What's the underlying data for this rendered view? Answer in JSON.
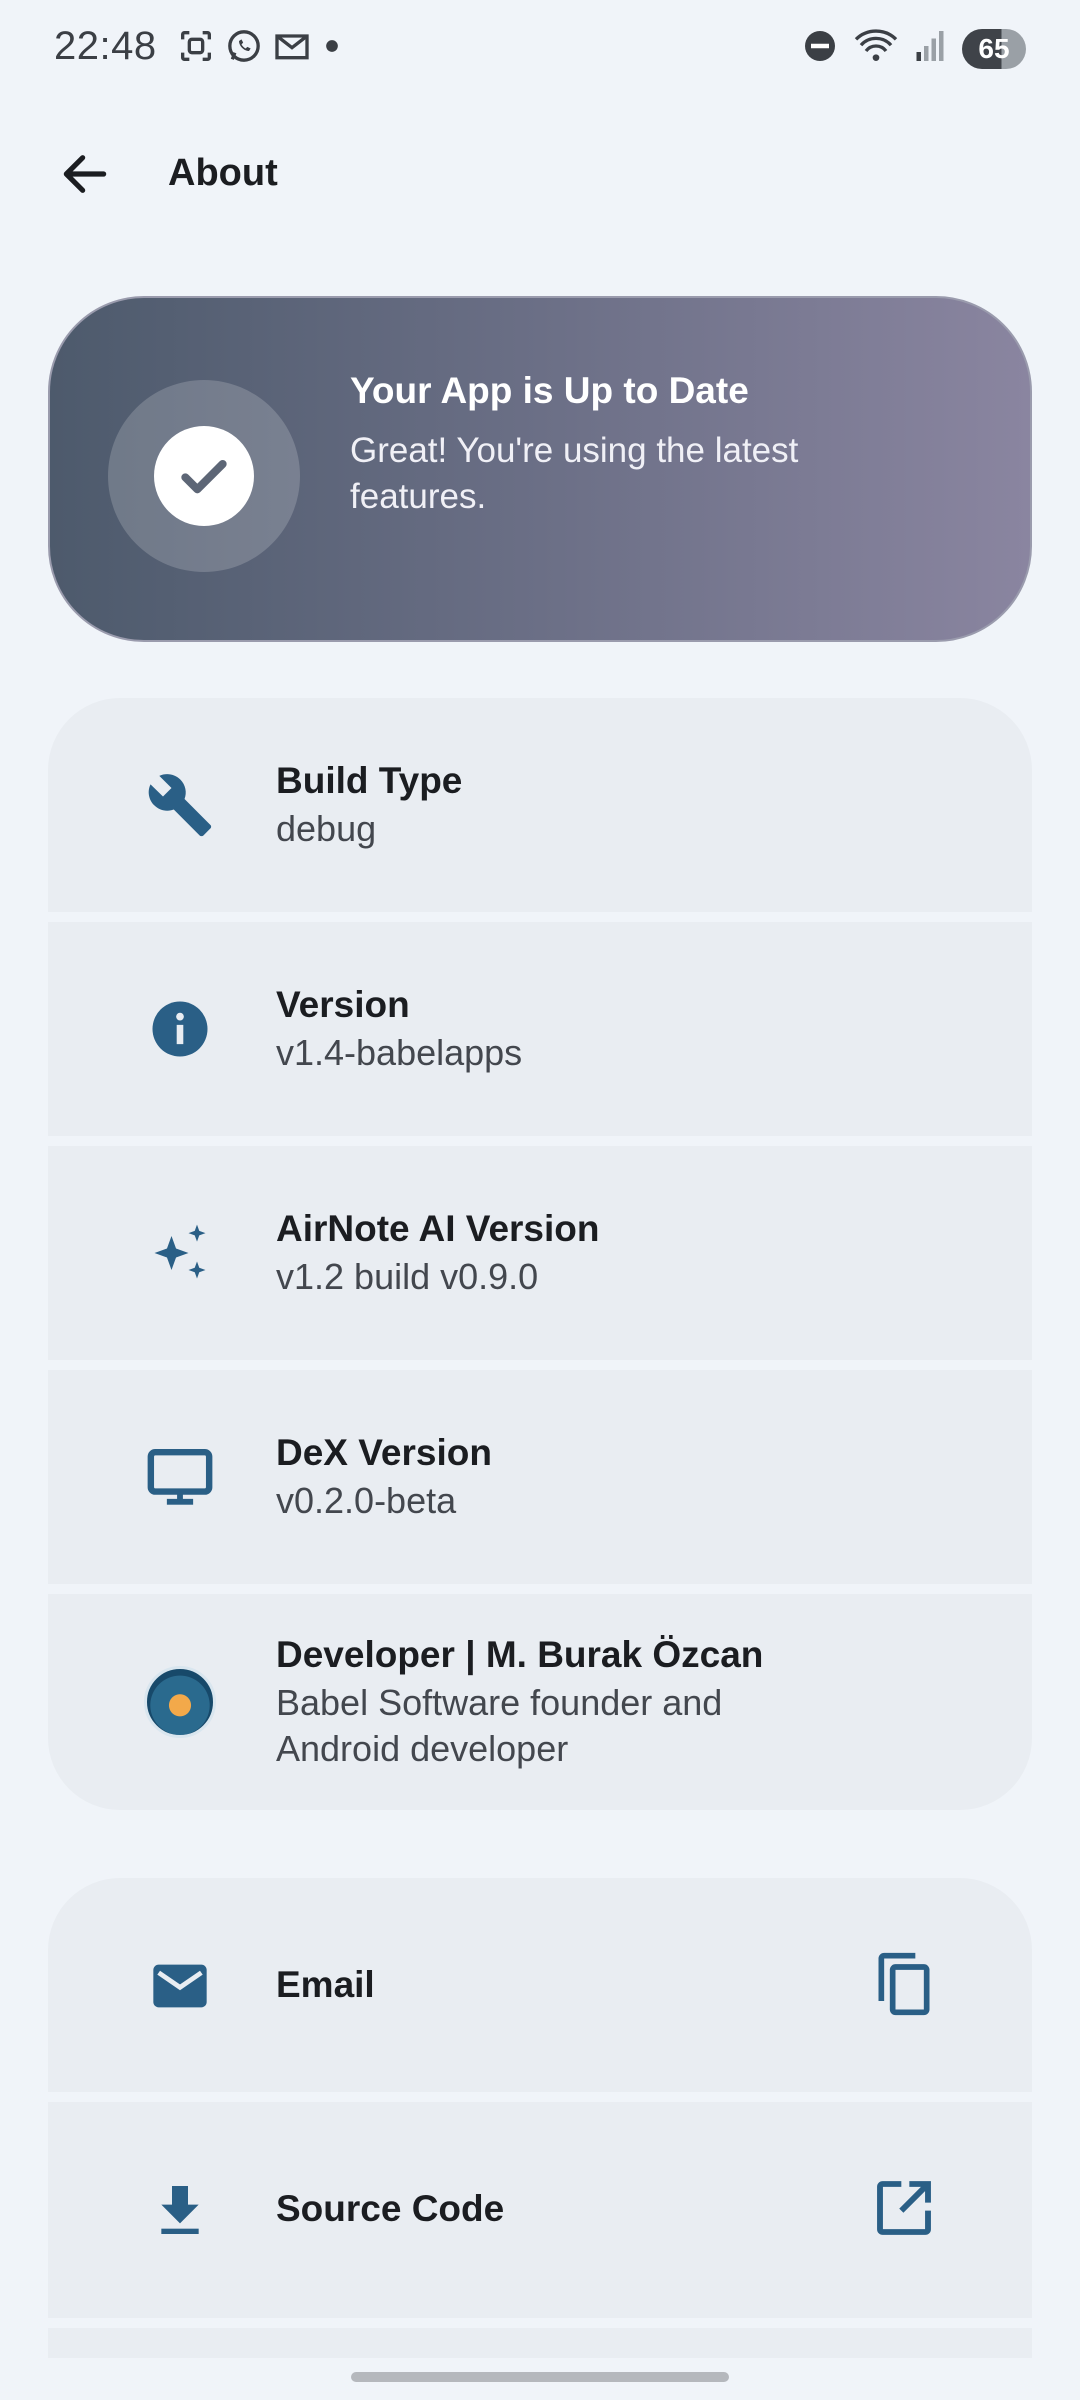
{
  "status_bar": {
    "time": "22:48",
    "battery": "65",
    "left_icons": [
      "screenshot-icon",
      "whatsapp-icon",
      "gmail-icon",
      "dot-icon"
    ],
    "right_icons": [
      "do-not-disturb-icon",
      "wifi-icon",
      "signal-icon",
      "battery-icon"
    ]
  },
  "app_bar": {
    "title": "About",
    "back_icon": "arrow-back-icon"
  },
  "update_banner": {
    "title": "Your App is Up to Date",
    "subtitle": "Great! You're using the latest features.",
    "icon": "check-circle-icon"
  },
  "info_items": [
    {
      "label": "Build Type",
      "value": "debug",
      "icon": "wrench-icon"
    },
    {
      "label": "Version",
      "value": "v1.4-babelapps",
      "icon": "info-icon"
    },
    {
      "label": "AirNote AI Version",
      "value": "v1.2 build v0.9.0",
      "icon": "sparkles-icon"
    },
    {
      "label": "DeX Version",
      "value": "v0.2.0-beta",
      "icon": "monitor-icon"
    },
    {
      "label": "Developer | M. Burak Özcan",
      "value": "Babel Software founder and Android developer",
      "icon": "avatar"
    }
  ],
  "link_items": [
    {
      "label": "Email",
      "icon": "email-icon",
      "action_icon": "copy-icon"
    },
    {
      "label": "Source Code",
      "icon": "download-icon",
      "action_icon": "open-external-icon"
    }
  ],
  "colors": {
    "background": "#f0f4f9",
    "card": "#e9edf2",
    "accent": "#2a5f86",
    "banner_start": "#4d5a6c",
    "banner_end": "#8a85a0"
  }
}
